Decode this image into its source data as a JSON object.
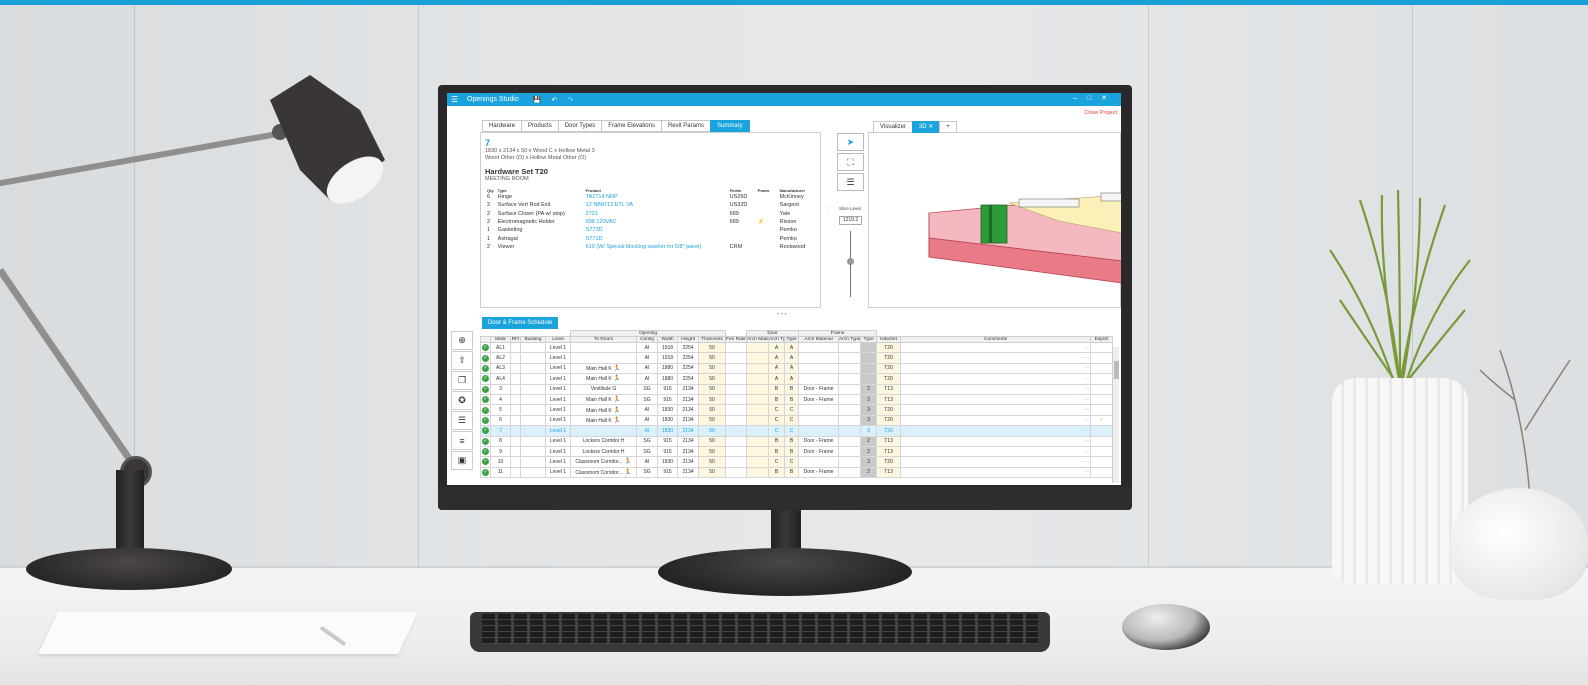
{
  "app": {
    "title": "Openings Studio",
    "close_project": "Close Project",
    "window_controls": [
      "–",
      "□",
      "✕"
    ]
  },
  "top_tabs": [
    {
      "label": "Hardware",
      "active": false
    },
    {
      "label": "Products",
      "active": false
    },
    {
      "label": "Door Types",
      "active": false
    },
    {
      "label": "Frame Elevations",
      "active": false
    },
    {
      "label": "Revit Params",
      "active": false
    },
    {
      "label": "Summary",
      "active": true
    }
  ],
  "summary": {
    "number": "7",
    "line1": "1830 x 2134 x 50 x Wood C x Hollow Metal 3",
    "line2": "Wood Other (O) x Hollow Metal Other (O)",
    "hw_title": "Hardware Set T20",
    "hw_room": "MEETING ROOM",
    "headers": [
      "Qty",
      "Type",
      "Product",
      "Finish",
      "Power",
      "Manufacturer"
    ],
    "rows": [
      {
        "qty": "6",
        "type": "Hinge",
        "product": "TA2714 NRP",
        "finish": "US26D",
        "power": "",
        "mfr": "McKinney"
      },
      {
        "qty": "2",
        "type": "Surface Vert Rod Exit",
        "product": "12 NB8713 ETL VA",
        "finish": "US32D",
        "power": "",
        "mfr": "Sargent"
      },
      {
        "qty": "2",
        "type": "Surface Closer (PA w/ stop)",
        "product": "2721",
        "finish": "689",
        "power": "",
        "mfr": "Yale"
      },
      {
        "qty": "2",
        "type": "Electromagnetic Holder",
        "product": "998 120VAC",
        "finish": "689",
        "power": "⚡",
        "mfr": "Rixson"
      },
      {
        "qty": "1",
        "type": "Gasketing",
        "product": "S773D",
        "finish": "",
        "power": "",
        "mfr": "Pemko"
      },
      {
        "qty": "1",
        "type": "Astragal",
        "product": "S771D",
        "finish": "",
        "power": "",
        "mfr": "Pemko"
      },
      {
        "qty": "2",
        "type": "Viewer",
        "product": "619 (W/ Special blocking washer for 5/8\" panel)",
        "finish": "CRM",
        "power": "",
        "mfr": "Rockwood"
      }
    ]
  },
  "tools": {
    "slice_label": "Slice Level",
    "slice_value": "1219.2",
    "slider_level_fraction": 0.55
  },
  "visualizer": {
    "tabs": [
      {
        "label": "Visualizer",
        "active": false
      },
      {
        "label": "3D ✕",
        "active": true
      },
      {
        "label": "+",
        "active": false
      }
    ]
  },
  "schedule": {
    "tab_label": "Door & Frame Schedule",
    "group_headers": {
      "opening": "Opening",
      "door": "Door",
      "frame": "Frame"
    },
    "columns": [
      "",
      "Mark",
      "RFI",
      "Building",
      "Level",
      "To Room",
      "Config",
      "Width",
      "Height",
      "Thickness",
      "Fire Rating",
      "Arch Material",
      "Arch Type",
      "Type",
      "Arch Material",
      "Arch Type",
      "Type",
      "HdwSet",
      "Comments",
      "Export"
    ],
    "rows": [
      {
        "mark": "AL1",
        "level": "Level 1",
        "room": "",
        "run": false,
        "config": "AI",
        "width": "1918",
        "height": "2254",
        "thick": "50",
        "d_arch_type": "A",
        "d_type": "A",
        "f_mat": "",
        "f_type": "",
        "hdw": "T20",
        "export": "",
        "hl": false
      },
      {
        "mark": "AL2",
        "level": "Level 1",
        "room": "",
        "run": false,
        "config": "AI",
        "width": "1918",
        "height": "2254",
        "thick": "50",
        "d_arch_type": "A",
        "d_type": "A",
        "f_mat": "",
        "f_type": "",
        "hdw": "T20",
        "export": "",
        "hl": false
      },
      {
        "mark": "AL3",
        "level": "Level 1",
        "room": "Main Hall K",
        "run": true,
        "config": "AI",
        "width": "1880",
        "height": "2254",
        "thick": "50",
        "d_arch_type": "A",
        "d_type": "A",
        "f_mat": "",
        "f_type": "",
        "hdw": "T20",
        "export": "",
        "hl": false
      },
      {
        "mark": "AL4",
        "level": "Level 1",
        "room": "Main Hall K",
        "run": true,
        "config": "AI",
        "width": "1880",
        "height": "2254",
        "thick": "50",
        "d_arch_type": "A",
        "d_type": "A",
        "f_mat": "",
        "f_type": "",
        "hdw": "T20",
        "export": "",
        "hl": false
      },
      {
        "mark": "3",
        "level": "Level 1",
        "room": "Vestibule G",
        "run": false,
        "config": "SG",
        "width": "915",
        "height": "2134",
        "thick": "50",
        "d_arch_type": "B",
        "d_type": "B",
        "f_mat": "Door - Frame",
        "f_type": "2",
        "hdw": "T13",
        "export": "",
        "hl": false
      },
      {
        "mark": "4",
        "level": "Level 1",
        "room": "Main Hall K",
        "run": true,
        "config": "SG",
        "width": "915",
        "height": "2134",
        "thick": "50",
        "d_arch_type": "B",
        "d_type": "B",
        "f_mat": "Door - Frame",
        "f_type": "2",
        "hdw": "T13",
        "export": "",
        "hl": false
      },
      {
        "mark": "5",
        "level": "Level 1",
        "room": "Main Hall K",
        "run": true,
        "config": "AI",
        "width": "1830",
        "height": "2134",
        "thick": "50",
        "d_arch_type": "C",
        "d_type": "C",
        "f_mat": "",
        "f_type": "3",
        "hdw": "T20",
        "export": "",
        "hl": false
      },
      {
        "mark": "6",
        "level": "Level 1",
        "room": "Main Hall K",
        "run": true,
        "config": "AI",
        "width": "1830",
        "height": "2134",
        "thick": "50",
        "d_arch_type": "C",
        "d_type": "C",
        "f_mat": "",
        "f_type": "3",
        "hdw": "T20",
        "export": "✓",
        "hl": false
      },
      {
        "mark": "7",
        "level": "Level 1",
        "room": "",
        "run": false,
        "config": "AI",
        "width": "1830",
        "height": "2134",
        "thick": "50",
        "d_arch_type": "C",
        "d_type": "C",
        "f_mat": "",
        "f_type": "3",
        "hdw": "T20",
        "export": "",
        "hl": true
      },
      {
        "mark": "8",
        "level": "Level 1",
        "room": "Lockers Corridor H",
        "run": false,
        "config": "SG",
        "width": "915",
        "height": "2134",
        "thick": "50",
        "d_arch_type": "B",
        "d_type": "B",
        "f_mat": "Door - Frame",
        "f_type": "2",
        "hdw": "T13",
        "export": "",
        "hl": false
      },
      {
        "mark": "9",
        "level": "Level 1",
        "room": "Lockers Corridor H",
        "run": false,
        "config": "SG",
        "width": "915",
        "height": "2134",
        "thick": "50",
        "d_arch_type": "B",
        "d_type": "B",
        "f_mat": "Door - Frame",
        "f_type": "2",
        "hdw": "T13",
        "export": "",
        "hl": false
      },
      {
        "mark": "10",
        "level": "Level 1",
        "room": "Classroom Corridor...",
        "run": true,
        "config": "AI",
        "width": "1830",
        "height": "2134",
        "thick": "50",
        "d_arch_type": "C",
        "d_type": "C",
        "f_mat": "",
        "f_type": "3",
        "hdw": "T20",
        "export": "",
        "hl": false
      },
      {
        "mark": "11",
        "level": "Level 1",
        "room": "Classroom Corridor...",
        "run": true,
        "config": "SG",
        "width": "915",
        "height": "2134",
        "thick": "50",
        "d_arch_type": "B",
        "d_type": "B",
        "f_mat": "Door - Frame",
        "f_type": "2",
        "hdw": "T13",
        "export": "",
        "hl": false
      }
    ]
  },
  "colors": {
    "accent": "#1aa3dc",
    "close_project": "#e03a2a",
    "check": "#3da24a"
  }
}
